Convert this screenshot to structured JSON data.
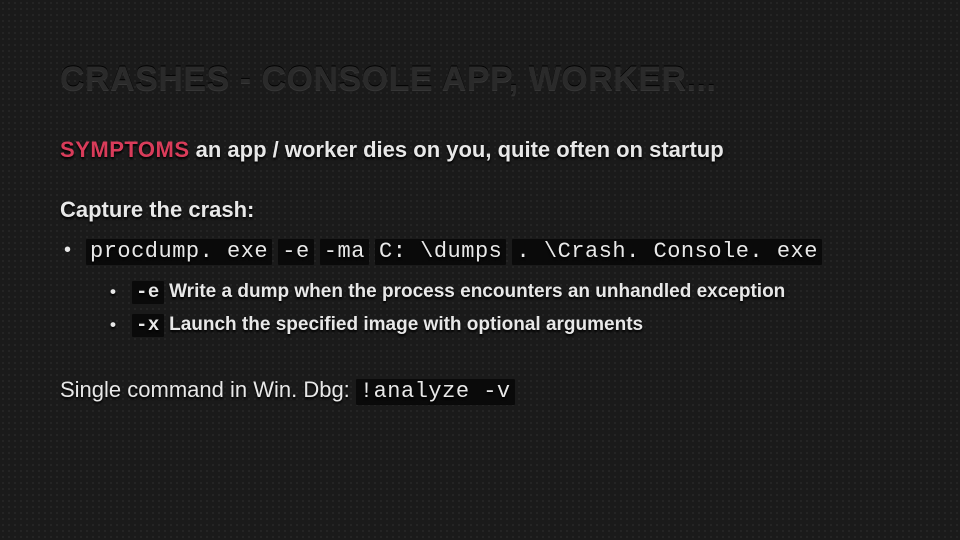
{
  "title": "CRASHES - CONSOLE APP, WORKER...",
  "symptoms_label_lead": "S",
  "symptoms_label_rest": "YMPTOMS",
  "symptoms_text": " an app / worker dies on you, quite often on startup",
  "capture_label": "Capture the crash:",
  "cmd": {
    "part1": "procdump. exe",
    "part2": "-e",
    "part3": "-ma",
    "part4": "C: \\dumps",
    "part5": ". \\Crash. Console. exe"
  },
  "flag_e": {
    "flag": "-e",
    "desc": " Write a dump when the process encounters an unhandled exception"
  },
  "flag_x": {
    "flag": "-x",
    "desc": " Launch the specified image with optional arguments"
  },
  "single_lead": "Single command in Win. Dbg: ",
  "single_cmd": "!analyze -v"
}
